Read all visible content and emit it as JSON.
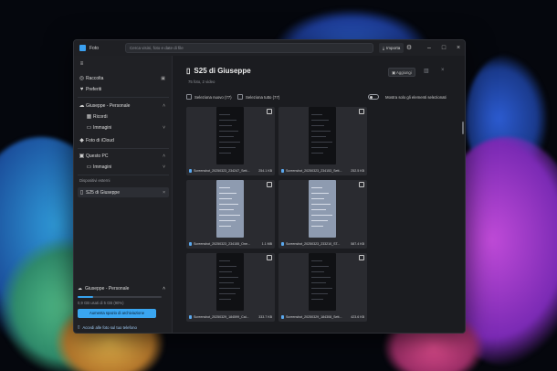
{
  "window": {
    "app_title": "Foto",
    "search_placeholder": "Cerca visini, foto e date di file",
    "import_label": "Importa"
  },
  "sidebar": {
    "items": [
      {
        "label": "Raccolta",
        "icon": "collection-icon"
      },
      {
        "label": "Preferiti",
        "icon": "heart-icon"
      },
      {
        "label": "Giuseppe - Personale",
        "icon": "cloud-icon"
      },
      {
        "label": "Ricordi",
        "icon": "memories-icon"
      },
      {
        "label": "Immagini",
        "icon": "folder-icon"
      },
      {
        "label": "Foto di iCloud",
        "icon": "icloud-icon"
      },
      {
        "label": "Questo PC",
        "icon": "computer-icon"
      },
      {
        "label": "Immagini",
        "icon": "folder-icon"
      }
    ],
    "devices_label": "Dispositivi esterni",
    "device_item": "S25 di Giuseppe",
    "account": {
      "title": "Giuseppe - Personale",
      "used_text": "0,9 GB usati di 5 GB (90%)",
      "used_fraction": 0.18,
      "button": "Aumenta spazio di archiviazione",
      "phone_link": "Accedi alle foto sul tuo telefono"
    }
  },
  "main": {
    "device_title": "S25 di Giuseppe",
    "subtitle": "75 foto, 2 video",
    "add_button": "Aggiungi",
    "select_new": "Seleziona nuovo (77)",
    "select_all": "Seleziona tutto (77)",
    "show_selected_only": "Mostra solo gli elementi selezionati",
    "items": [
      {
        "name": "Screenshot_20250323_234247_Sett...",
        "size": "254.1 KB",
        "light": false
      },
      {
        "name": "Screenshot_20250323_234153_Sett...",
        "size": "252.5 KB",
        "light": false
      },
      {
        "name": "Screenshot_20250323_234155_One...",
        "size": "1.1 MB",
        "light": true
      },
      {
        "name": "Screenshot_20250323_233210_ST...",
        "size": "587.4 KB",
        "light": true
      },
      {
        "name": "Screenshot_20250329_184599_Cal...",
        "size": "333.7 KB",
        "light": false
      },
      {
        "name": "Screenshot_20250329_184308_Sett...",
        "size": "423.6 KB",
        "light": false
      }
    ]
  }
}
